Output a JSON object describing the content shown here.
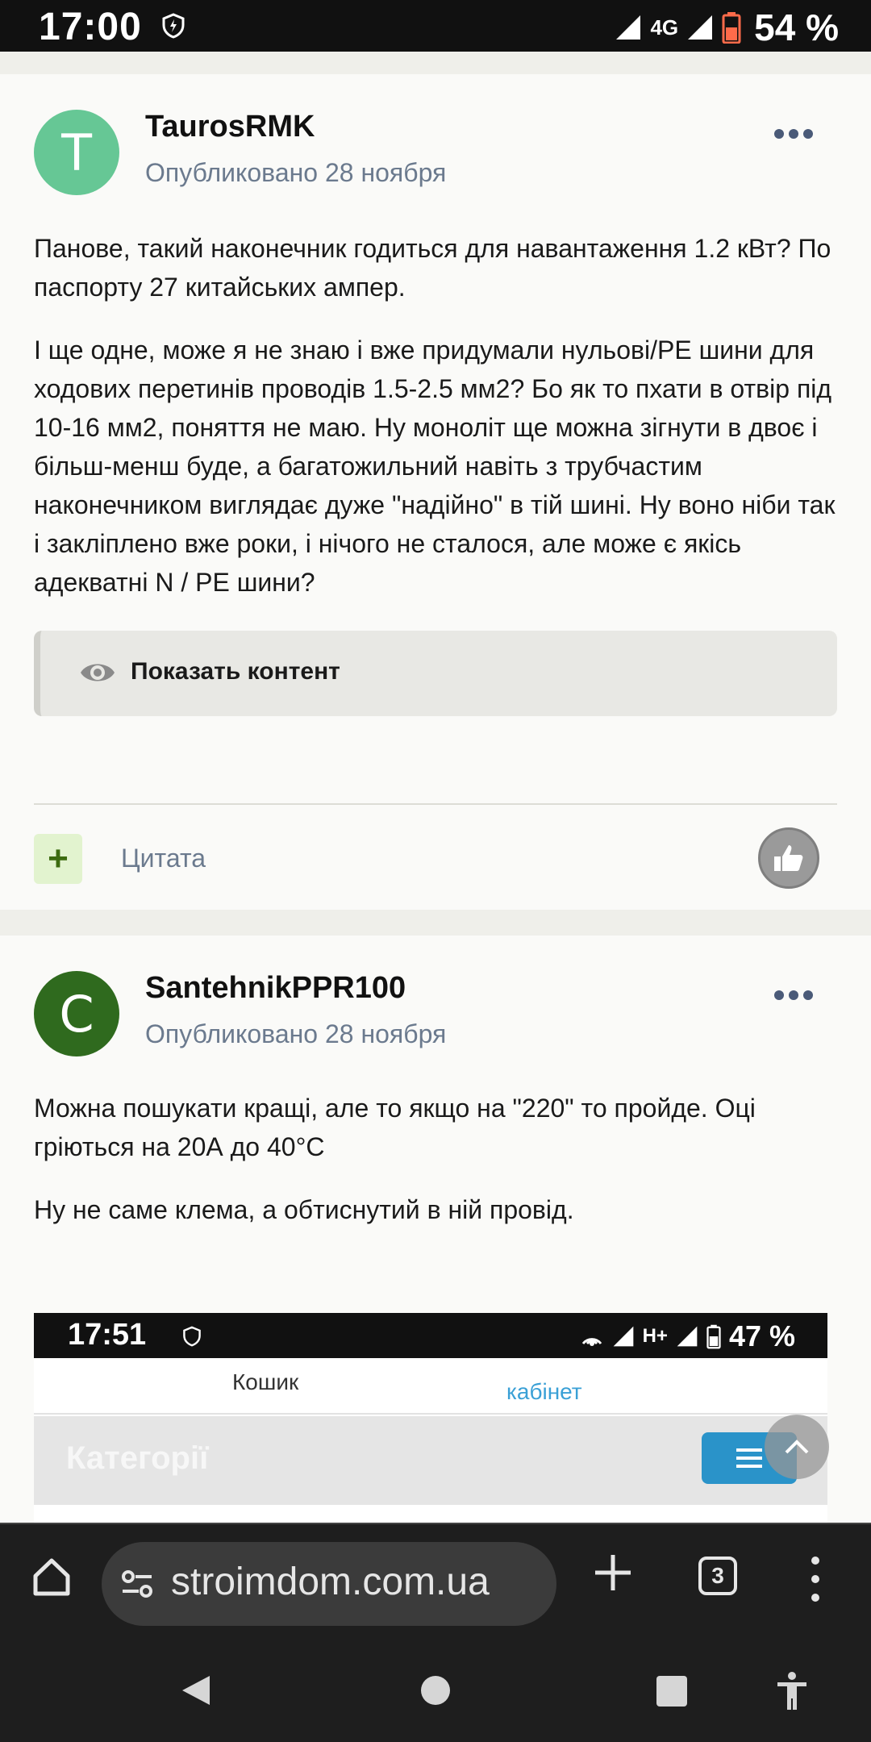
{
  "status_bar": {
    "time": "17:00",
    "network": "4G",
    "battery": "54 %"
  },
  "posts": [
    {
      "avatar_letter": "T",
      "avatar_color": "#66c795",
      "author": "TaurosRMK",
      "date": "Опубликовано 28 ноября",
      "paragraphs": [
        "Панове, такий наконечник годиться для навантаження 1.2 кВт? По паспорту 27 китайських ампер.",
        "І ще одне, може я не знаю і вже придумали нульові/PE шини для ходових перетинів проводів 1.5-2.5 мм2? Бо як то пхати в отвір під 10-16 мм2, поняття не маю. Ну моноліт ще можна зігнути в двоє і більш-менш буде, а багатожильний навіть з трубчастим наконечником виглядає дуже \"надійно\" в тій шині. Ну воно ніби так і закліплено вже роки, і нічого не сталося, але може є якісь адекватні N / PE шини?"
      ],
      "spoiler_label": "Показать контент",
      "quote_label": "Цитата",
      "plus_label": "+"
    },
    {
      "avatar_letter": "C",
      "avatar_color": "#2f6a1e",
      "author": "SantehnikPPR100",
      "date": "Опубликовано 28 ноября",
      "paragraphs": [
        "Можна пошукати кращі, але то якщо на \"220\" то пройде. Оці гріються на 20А до 40°С",
        "Ну не саме клема, а обтиснутий в ній провід."
      ]
    }
  ],
  "embedded_screenshot": {
    "time": "17:51",
    "network": "H+",
    "battery": "47 %",
    "tab_cart": "Кошик",
    "tab_cabinet": "кабінет",
    "category_label": "Категорії"
  },
  "browser": {
    "url": "stroimdom.com.ua",
    "tab_count": "3"
  },
  "colors": {
    "accent_link": "#6b7a8e",
    "plus_bg": "#e2f3cf"
  }
}
